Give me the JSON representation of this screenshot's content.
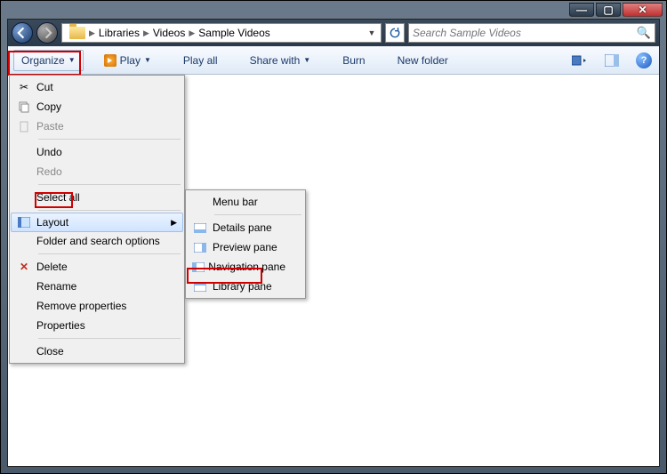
{
  "titlebar": {
    "min": "—",
    "max": "▢",
    "close": "✕"
  },
  "breadcrumb": {
    "items": [
      "Libraries",
      "Videos",
      "Sample Videos"
    ]
  },
  "search": {
    "placeholder": "Search Sample Videos"
  },
  "toolbar": {
    "organize": "Organize",
    "play": "Play",
    "playall": "Play all",
    "share": "Share with",
    "burn": "Burn",
    "newfolder": "New folder"
  },
  "organize_menu": {
    "cut": "Cut",
    "copy": "Copy",
    "paste": "Paste",
    "undo": "Undo",
    "redo": "Redo",
    "selectall": "Select all",
    "layout": "Layout",
    "folderopts": "Folder and search options",
    "delete": "Delete",
    "rename": "Rename",
    "removeprops": "Remove properties",
    "properties": "Properties",
    "close": "Close"
  },
  "layout_menu": {
    "menubar": "Menu bar",
    "details": "Details pane",
    "preview": "Preview pane",
    "navigation": "Navigation pane",
    "library": "Library pane"
  }
}
